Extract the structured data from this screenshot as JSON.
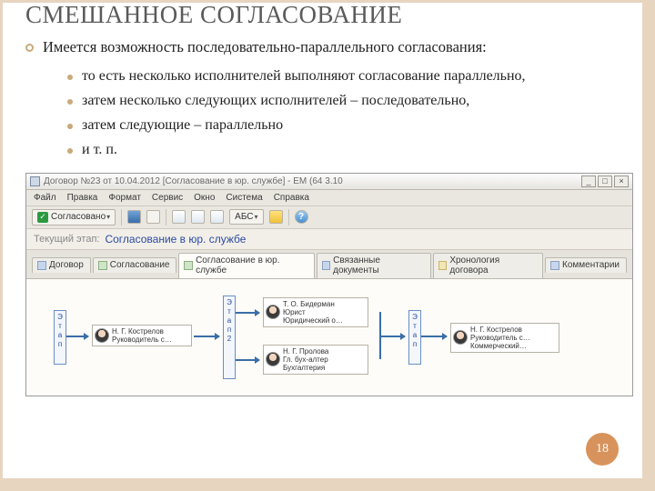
{
  "slide": {
    "title": "СМЕШАННОЕ СОГЛАСОВАНИЕ",
    "lead": "Имеется возможность последовательно-параллельного согласования:",
    "bullets": [
      "то есть несколько исполнителей выполняют согласование параллельно,",
      "затем несколько следующих исполнителей – последовательно,",
      "затем следующие – параллельно",
      "и т. п."
    ],
    "page_number": "18"
  },
  "app": {
    "titlebar": "Договор №23 от 10.04.2012 [Согласование в юр. службе] - ЕМ (64 3.10",
    "window_buttons": {
      "min": "_",
      "max": "□",
      "close": "×"
    },
    "menu": [
      "Файл",
      "Правка",
      "Формат",
      "Сервис",
      "Окно",
      "Система",
      "Справка"
    ],
    "toolbar": {
      "approved": "Согласовано",
      "abc_label": "АБС"
    },
    "stage": {
      "label": "Текущий этап:",
      "value": "Согласование в юр. службе"
    },
    "tabs": [
      "Договор",
      "Согласование",
      "Согласование в юр. службе",
      "Связанные документы",
      "Хронология договора",
      "Комментарии"
    ],
    "stage_label": "Этап",
    "persons": {
      "p1": {
        "name": "Н. Г. Кострелов",
        "role": "Руководитель с…"
      },
      "p2": {
        "name": "Т. О. Бидерман",
        "role": "Юрист",
        "dept": "Юридический о…"
      },
      "p3": {
        "name": "Н. Г. Пролова",
        "role": "Гл. бух-алтер",
        "dept": "Бухгалтерия"
      },
      "p4": {
        "name": "Н. Г. Кострелов",
        "role": "Руководитель с…",
        "dept": "Коммерческий…"
      }
    }
  }
}
